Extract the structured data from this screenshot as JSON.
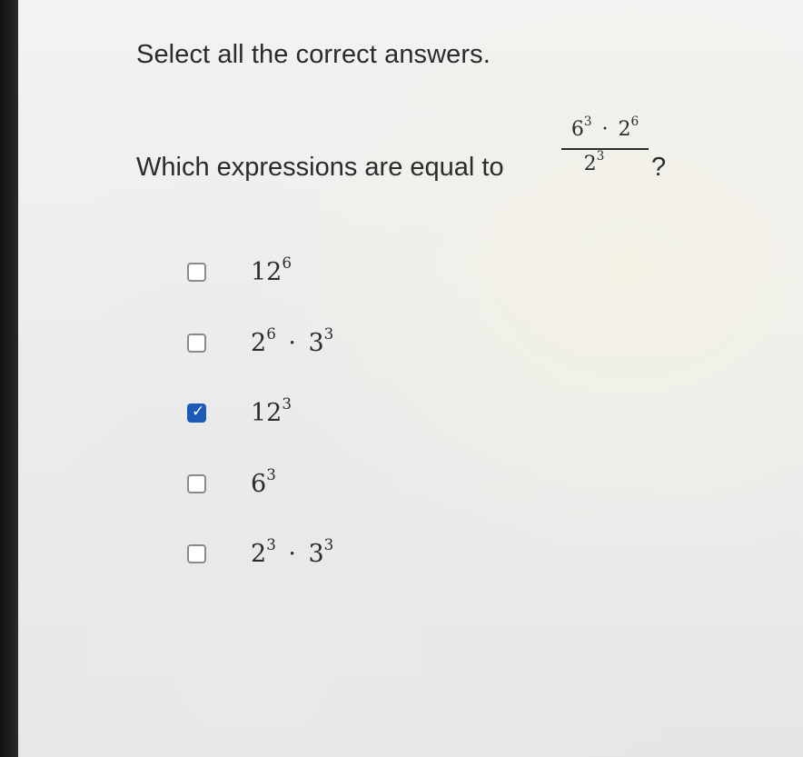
{
  "instruction": "Select all the correct answers.",
  "question": {
    "prefix": "Which expressions are equal to",
    "numerator": "6^3 · 2^6",
    "denominator": "2^3",
    "suffix": "?"
  },
  "options": [
    {
      "expression": "12^6",
      "checked": false
    },
    {
      "expression": "2^6 · 3^3",
      "checked": false
    },
    {
      "expression": "12^3",
      "checked": true
    },
    {
      "expression": "6^3",
      "checked": false
    },
    {
      "expression": "2^3 · 3^3",
      "checked": false
    }
  ],
  "icons": {
    "checked_box": "checkbox-checked-icon",
    "unchecked_box": "checkbox-unchecked-icon"
  },
  "colors": {
    "checked_fill": "#1d5ab8",
    "text": "#2b2b2b",
    "checkbox_border": "#8a8a8a"
  }
}
